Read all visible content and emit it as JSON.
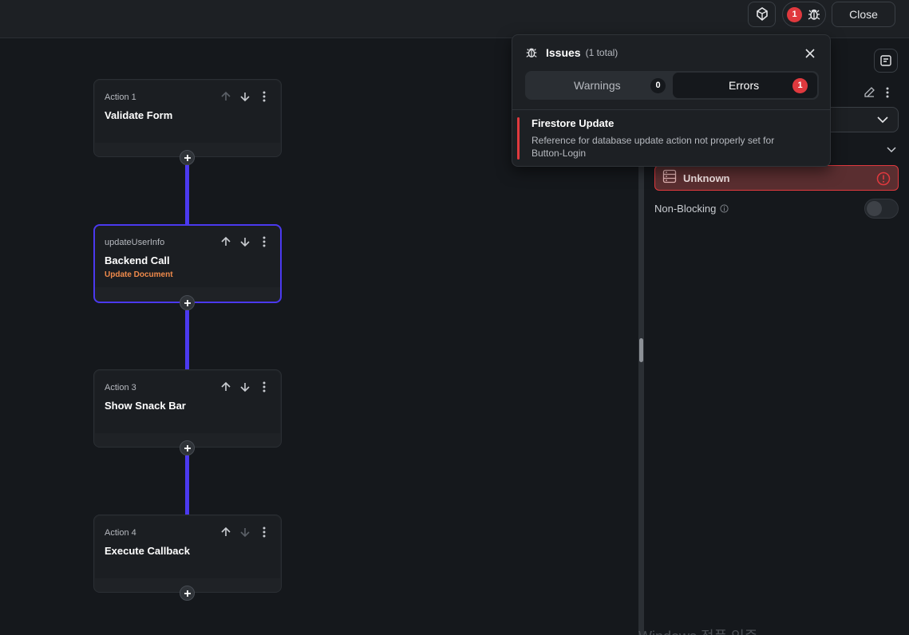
{
  "topbar": {
    "issues_badge": "1",
    "close_label": "Close"
  },
  "actions": [
    {
      "subtitle": "Action 1",
      "title": "Validate Form",
      "detail": ""
    },
    {
      "subtitle": "updateUserInfo",
      "title": "Backend Call",
      "detail": "Update Document"
    },
    {
      "subtitle": "Action 3",
      "title": "Show Snack Bar",
      "detail": ""
    },
    {
      "subtitle": "Action 4",
      "title": "Execute Callback",
      "detail": ""
    }
  ],
  "issues_popup": {
    "title": "Issues",
    "count_text": "(1 total)",
    "tabs": {
      "warnings_label": "Warnings",
      "warnings_count": "0",
      "errors_label": "Errors",
      "errors_count": "1"
    },
    "issue": {
      "title": "Firestore Update",
      "description": "Reference for database update action not properly set for Button-Login"
    }
  },
  "right_panel": {
    "field_value": "Unknown",
    "non_blocking_label": "Non-Blocking"
  },
  "watermark": "Windows 정품 인증",
  "colors": {
    "accent": "#4b39ef",
    "error": "#e0393e",
    "detail": "#f08a4b"
  }
}
